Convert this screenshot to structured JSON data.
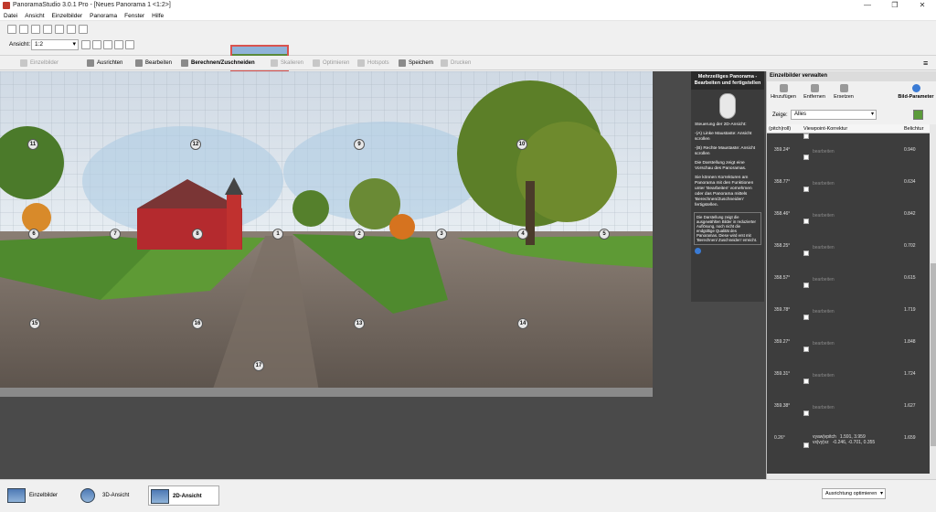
{
  "window": {
    "title": "PanoramaStudio 3.0.1 Pro - [Neues Panorama 1 <1:2>]"
  },
  "menu": [
    "Datei",
    "Ansicht",
    "Einzelbilder",
    "Panorama",
    "Fenster",
    "Hilfe"
  ],
  "toolbar": {
    "ansicht_label": "Ansicht:",
    "ansicht_value": "1:2"
  },
  "actions": [
    {
      "label": "Einzelbilder",
      "enabled": false
    },
    {
      "label": "Ausrichten",
      "enabled": true
    },
    {
      "label": "Bearbeiten",
      "enabled": true
    },
    {
      "label": "Berechnen/Zuschneiden",
      "enabled": true
    },
    {
      "label": "Skalieren",
      "enabled": false
    },
    {
      "label": "Optimieren",
      "enabled": false
    },
    {
      "label": "Hotspots",
      "enabled": false
    },
    {
      "label": "Speichern",
      "enabled": true
    },
    {
      "label": "Drucken",
      "enabled": false
    }
  ],
  "markers": [
    "1",
    "2",
    "3",
    "4",
    "5",
    "6",
    "7",
    "8",
    "9",
    "10",
    "11",
    "12",
    "13",
    "14",
    "15",
    "16",
    "17"
  ],
  "guide": {
    "title": "Mehrzeiliges Panorama - Bearbeiten und fertigstellen",
    "p1": "Steuerung der 2D-Ansicht:",
    "p2": "-(A) Linke Maustaste: Ansicht scrollen",
    "p3": "-(B) Rechte Maustaste: Ansicht scrollen",
    "p4": "Die Darstellung zeigt eine Vorschau des Panoramas.",
    "p5": "Sie können Korrekturen am Panorama mit den Funktionen unter 'Bearbeiten' vornehmen oder das Panorama mittels 'Berechnen/Zuschneiden' fertigstellen.",
    "note": "Die Darstellung zeigt die ausgewählten Bilder in reduzierter Auflösung, noch nicht die endgültige Qualität des Panoramas. Diese wird erst mit 'Berechnen/ Zuschneiden' erreicht."
  },
  "rpanel": {
    "title": "Einzelbilder verwalten",
    "buttons": [
      "Hinzufügen",
      "Entfernen",
      "Ersetzen",
      "Bild-Parameter"
    ],
    "zeige_label": "Zeige:",
    "zeige_value": "Alles",
    "headers": [
      "(pitch|roll)",
      "Viewpoint-Korrektur",
      "Belichtur"
    ],
    "rows": [
      {
        "pitch": "359.24°",
        "edit": "bearbeiten",
        "bel": "0.940"
      },
      {
        "pitch": "358.77°",
        "edit": "bearbeiten",
        "bel": "0.634"
      },
      {
        "pitch": "358.46°",
        "edit": "bearbeiten",
        "bel": "0.842"
      },
      {
        "pitch": "358.25°",
        "edit": "bearbeiten",
        "bel": "0.702"
      },
      {
        "pitch": "358.57°",
        "edit": "bearbeiten",
        "bel": "0.615"
      },
      {
        "pitch": "359.78°",
        "edit": "bearbeiten",
        "bel": "1.719"
      },
      {
        "pitch": "359.27°",
        "edit": "bearbeiten",
        "bel": "1.848"
      },
      {
        "pitch": "359.31°",
        "edit": "bearbeiten",
        "bel": "1.724"
      },
      {
        "pitch": "359.38°",
        "edit": "bearbeiten",
        "bel": "1.627"
      },
      {
        "pitch": "0.26°",
        "edit": "vyaw|vpitch   1.591, 3.959\nvx|vy|vz   -0.246, -0.701, 0.355",
        "bel": "1.659"
      }
    ]
  },
  "status": {
    "tabs": [
      "Einzelbilder",
      "3D-Ansicht",
      "2D-Ansicht"
    ],
    "active_tab": "2D-Ansicht",
    "ausrichtung": "Ausrichtung optimieren"
  }
}
